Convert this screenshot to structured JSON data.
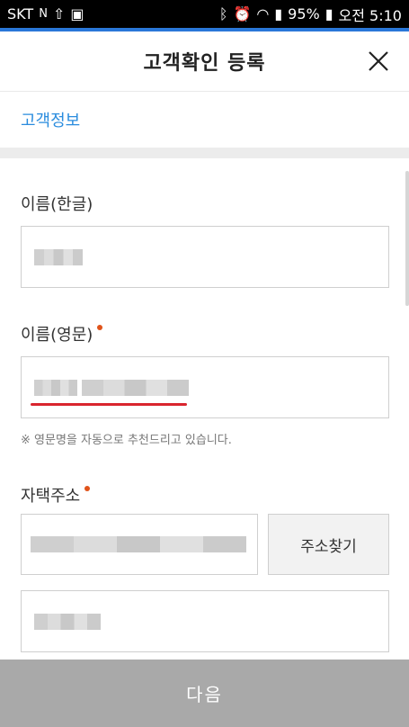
{
  "status_bar": {
    "carrier": "SKT",
    "battery": "95%",
    "time": "오전 5:10"
  },
  "header": {
    "title": "고객확인 등록",
    "close_icon": "close-icon"
  },
  "section_tab": {
    "label": "고객정보"
  },
  "form": {
    "name_korean_label": "이름(한글)",
    "name_english_label": "이름(영문)",
    "name_english_hint": "※ 영문명을 자동으로 추천드리고 있습니다.",
    "address_label": "자택주소",
    "address_search_button": "주소찾기"
  },
  "footer": {
    "next_button": "다음"
  },
  "colors": {
    "accent": "#2a8cde",
    "required_dot": "#e0531a",
    "underline": "#d9252e",
    "bottom_button": "#a9a9a9"
  }
}
